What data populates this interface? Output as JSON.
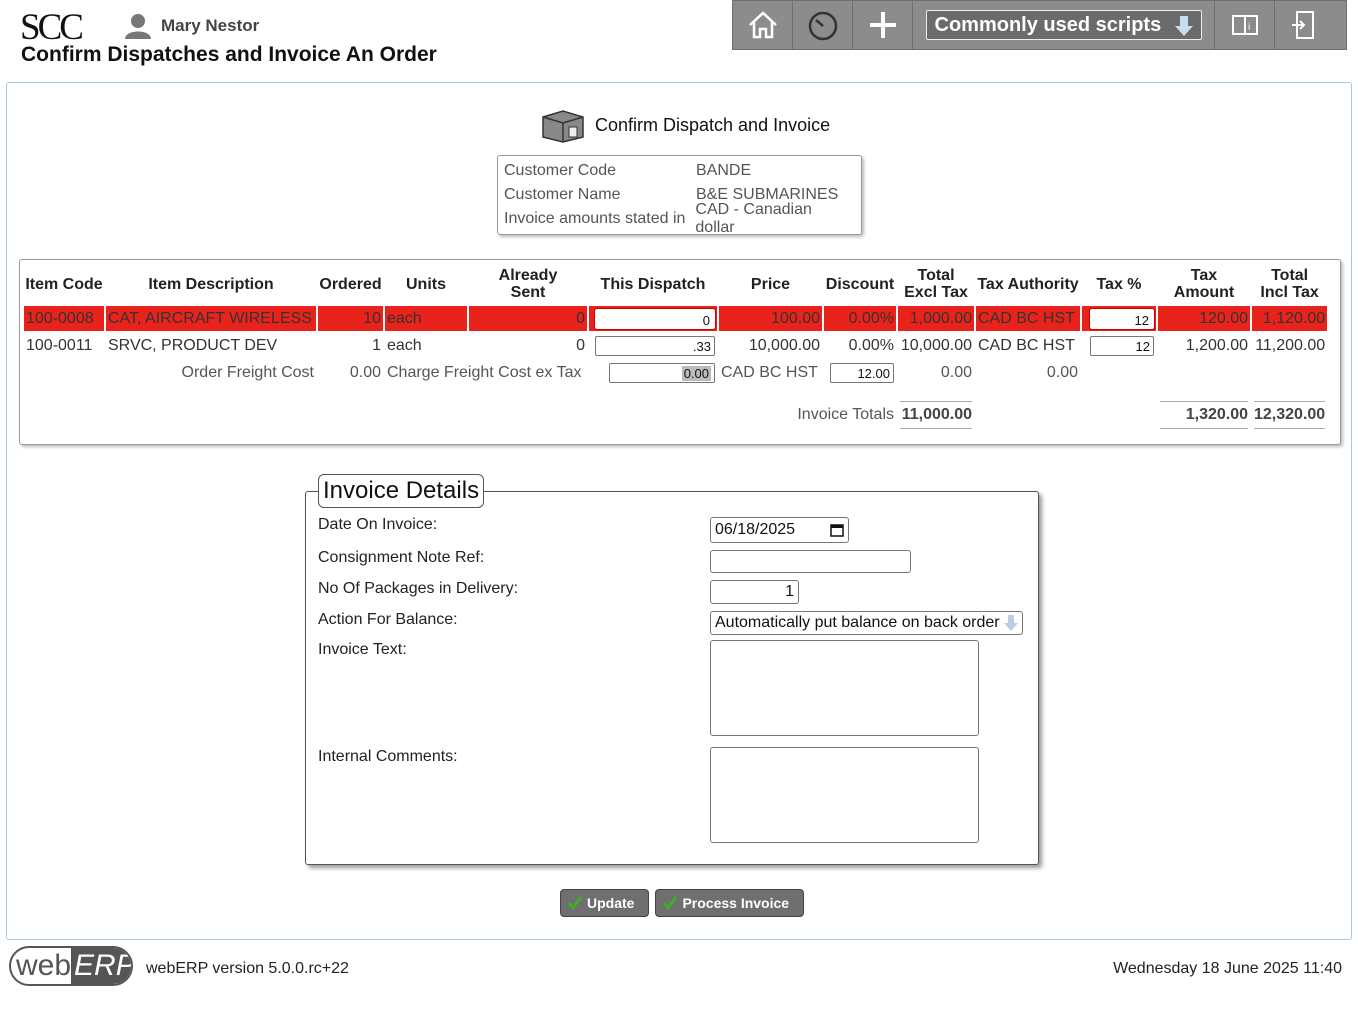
{
  "header": {
    "logo": "SCC",
    "user_name": "Mary Nestor",
    "page_title": "Confirm Dispatches and Invoice An Order",
    "scripts_label": "Commonly used scripts"
  },
  "panel": {
    "title": "Confirm Dispatch and Invoice",
    "customer": [
      {
        "label": "Customer Code",
        "value": "BANDE"
      },
      {
        "label": "Customer Name",
        "value": "B&E SUBMARINES"
      },
      {
        "label": "Invoice amounts stated in",
        "value": "CAD - Canadian dollar"
      }
    ]
  },
  "items": {
    "headers": {
      "item_code": "Item Code",
      "item_description": "Item Description",
      "ordered": "Ordered",
      "units": "Units",
      "already_sent_1": "Already",
      "already_sent_2": "Sent",
      "this_dispatch": "This Dispatch",
      "price": "Price",
      "discount": "Discount",
      "total_excl_1": "Total",
      "total_excl_2": "Excl Tax",
      "tax_authority": "Tax Authority",
      "tax_pct": "Tax %",
      "tax_amount": "Tax Amount",
      "total_incl_1": "Total",
      "total_incl_2": "Incl Tax"
    },
    "rows": [
      {
        "code": "100-0008",
        "description": "CAT, AIRCRAFT WIRELESS",
        "ordered": "10",
        "units": "each",
        "already_sent": "0",
        "this_dispatch": "0",
        "price": "100.00",
        "discount": "0.00%",
        "total_excl": "1,000.00",
        "tax_authority": "CAD BC HST",
        "tax_pct": "12",
        "tax_amount": "120.00",
        "total_incl": "1,120.00"
      },
      {
        "code": "100-0011",
        "description": "SRVC, PRODUCT DEV",
        "ordered": "1",
        "units": "each",
        "already_sent": "0",
        "this_dispatch": ".33",
        "price": "10,000.00",
        "discount": "0.00%",
        "total_excl": "10,000.00",
        "tax_authority": "CAD BC HST",
        "tax_pct": "12",
        "tax_amount": "1,200.00",
        "total_incl": "11,200.00"
      }
    ],
    "freight": {
      "order_label": "Order Freight Cost",
      "order_value": "0.00",
      "charge_label": "Charge Freight Cost ex Tax",
      "charge_value": "0.00",
      "tax_authority": "CAD BC HST",
      "tax_pct": "12.00",
      "tax_amount_1": "0.00",
      "tax_amount_2": "0.00"
    },
    "totals": {
      "label": "Invoice Totals",
      "excl_tax": "11,000.00",
      "tax_amount": "1,320.00",
      "incl_tax": "12,320.00"
    }
  },
  "invoice_details": {
    "legend": "Invoice Details",
    "date_label": "Date On Invoice:",
    "date_value": "06/18/2025",
    "consignment_label": "Consignment Note Ref:",
    "consignment_value": "",
    "packages_label": "No Of Packages in Delivery:",
    "packages_value": "1",
    "balance_label": "Action For Balance:",
    "balance_value": "Automatically put balance on back order",
    "invoice_text_label": "Invoice Text:",
    "internal_comments_label": "Internal Comments:"
  },
  "buttons": {
    "update": "Update",
    "process": "Process Invoice"
  },
  "footer": {
    "logo_web": "web",
    "logo_erp": "ERP",
    "version": "webERP version 5.0.0.rc+22",
    "datetime": "Wednesday 18 June 2025 11:40"
  },
  "colors": {
    "error_row": "#e9231b",
    "toolbar": "#8c8c8c",
    "panel_border": "#a9c6dd"
  }
}
